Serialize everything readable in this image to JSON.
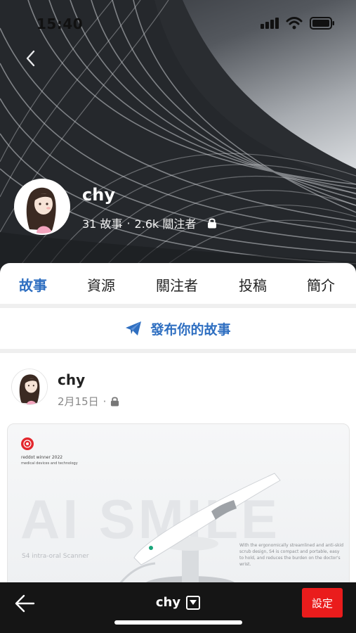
{
  "status_bar": {
    "time": "15:40",
    "icons": [
      "cellular-icon",
      "wifi-icon",
      "battery-icon"
    ]
  },
  "profile": {
    "name": "chy",
    "stories_count": "31 故事",
    "separator": "·",
    "followers_count": "2.6k 關注者",
    "locked": true
  },
  "tabs": [
    {
      "label": "故事",
      "active": true
    },
    {
      "label": "資源",
      "active": false
    },
    {
      "label": "關注者",
      "active": false
    },
    {
      "label": "投稿",
      "active": false
    },
    {
      "label": "簡介",
      "active": false
    }
  ],
  "post_story": {
    "label": "發布你的故事",
    "icon": "paper-plane-icon"
  },
  "story": {
    "author": "chy",
    "date": "2月15日",
    "separator": "·",
    "image": {
      "award_title": "reddot winner 2022",
      "award_category": "medical devices and technology",
      "watermark": "AI SMILE",
      "tagline": "S4 intra-oral Scanner",
      "description": "With the ergonomically streamlined and anti-skid scrub design, S4 is compact and portable, easy to hold, and reduces the burden on the doctor's wrist."
    }
  },
  "bottom_bar": {
    "title": "chy",
    "settings_label": "設定"
  },
  "colors": {
    "accent": "#2f6fc1",
    "danger": "#ea1c1c",
    "bottom_bar": "#151515"
  }
}
